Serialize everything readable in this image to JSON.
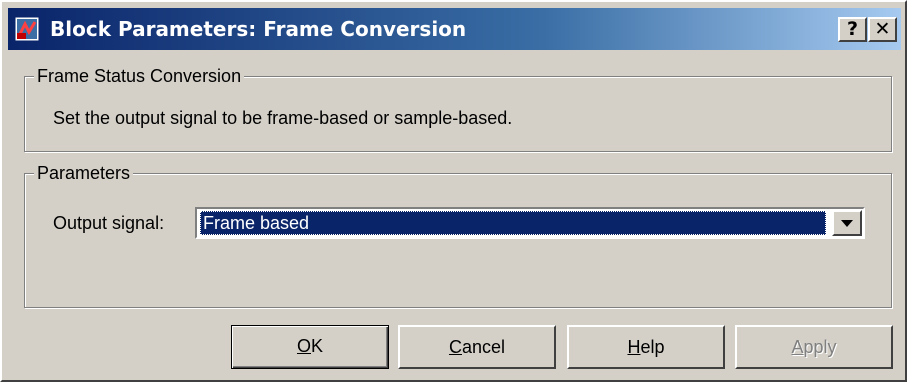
{
  "window": {
    "title": "Block Parameters: Frame Conversion",
    "help_button": "?",
    "close_button": "✕",
    "title_gradient_start": "#0a246a",
    "title_gradient_end": "#a6caf0"
  },
  "description_group": {
    "legend": "Frame Status Conversion",
    "text": "Set the output signal to be frame-based or sample-based."
  },
  "parameters_group": {
    "legend": "Parameters",
    "output_signal_label": "Output signal:",
    "output_signal_value": "Frame based"
  },
  "buttons": {
    "ok": {
      "mnemonic": "O",
      "rest": "K"
    },
    "cancel": {
      "mnemonic": "C",
      "rest": "ancel"
    },
    "help": {
      "mnemonic": "H",
      "rest": "elp"
    },
    "apply": {
      "mnemonic": "A",
      "rest": "pply"
    }
  },
  "icons": [
    "simulink-block-icon",
    "help-icon",
    "close-icon",
    "dropdown-arrow-icon"
  ]
}
